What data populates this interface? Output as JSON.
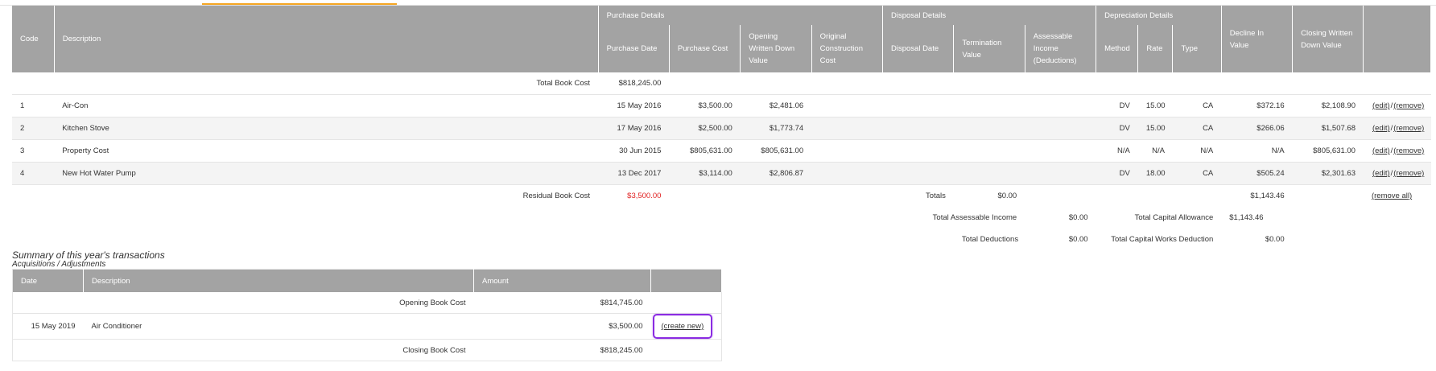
{
  "group_headers": {
    "purchase": "Purchase Details",
    "disposal": "Disposal Details",
    "depreciation": "Depreciation Details"
  },
  "columns": {
    "code": "Code",
    "description": "Description",
    "purchase_date": "Purchase Date",
    "purchase_cost": "Purchase Cost",
    "opening_wdv": "Opening Written Down Value",
    "original_construction_cost": "Original Construction Cost",
    "disposal_date": "Disposal Date",
    "termination_value": "Termination Value",
    "assessable_income": "Assessable Income (Deductions)",
    "method": "Method",
    "rate": "Rate",
    "type": "Type",
    "decline_in_value": "Decline In Value",
    "closing_wdv": "Closing Written Down Value"
  },
  "total_book_cost": {
    "label": "Total Book Cost",
    "value": "$818,245.00"
  },
  "assets": [
    {
      "code": "1",
      "description": "Air-Con",
      "purchase_date": "15 May 2016",
      "purchase_cost": "$3,500.00",
      "opening_wdv": "$2,481.06",
      "method": "DV",
      "rate": "15.00",
      "type": "CA",
      "decline": "$372.16",
      "closing": "$2,108.90"
    },
    {
      "code": "2",
      "description": "Kitchen Stove",
      "purchase_date": "17 May 2016",
      "purchase_cost": "$2,500.00",
      "opening_wdv": "$1,773.74",
      "method": "DV",
      "rate": "15.00",
      "type": "CA",
      "decline": "$266.06",
      "closing": "$1,507.68"
    },
    {
      "code": "3",
      "description": "Property Cost",
      "purchase_date": "30 Jun 2015",
      "purchase_cost": "$805,631.00",
      "opening_wdv": "$805,631.00",
      "method": "N/A",
      "rate": "N/A",
      "type": "N/A",
      "decline": "N/A",
      "closing": "$805,631.00"
    },
    {
      "code": "4",
      "description": "New Hot Water Pump",
      "purchase_date": "13 Dec 2017",
      "purchase_cost": "$3,114.00",
      "opening_wdv": "$2,806.87",
      "method": "DV",
      "rate": "18.00",
      "type": "CA",
      "decline": "$505.24",
      "closing": "$2,301.63"
    }
  ],
  "row_actions": {
    "edit": "(edit)",
    "sep": "/",
    "remove": "(remove)"
  },
  "residual": {
    "label": "Residual Book Cost",
    "value": "$3,500.00",
    "value_color": "#e02020"
  },
  "totals": {
    "label": "Totals",
    "value": "$0.00",
    "decline_total": "$1,143.46",
    "remove_all": "(remove all)"
  },
  "summary_rows": {
    "assessable_label": "Total Assessable Income",
    "assessable_value": "$0.00",
    "capital_allowance_label": "Total Capital Allowance",
    "capital_allowance_value": "$1,143.46",
    "deductions_label": "Total Deductions",
    "deductions_value": "$0.00",
    "capital_works_label": "Total Capital Works Deduction",
    "capital_works_value": "$0.00"
  },
  "transactions": {
    "title": "Summary of this year's transactions",
    "subtitle": "Acquisitions / Adjustments",
    "headers": {
      "date": "Date",
      "description": "Description",
      "amount": "Amount"
    },
    "opening": {
      "label": "Opening Book Cost",
      "value": "$814,745.00"
    },
    "row": {
      "date": "15 May 2019",
      "description": "Air Conditioner",
      "amount": "$3,500.00",
      "action": "(create new)"
    },
    "closing": {
      "label": "Closing Book Cost",
      "value": "$818,245.00"
    }
  },
  "colors": {
    "header_bg": "#a3a3a3",
    "accent_tab": "#f5a623",
    "highlight_box": "#8a2be2"
  }
}
